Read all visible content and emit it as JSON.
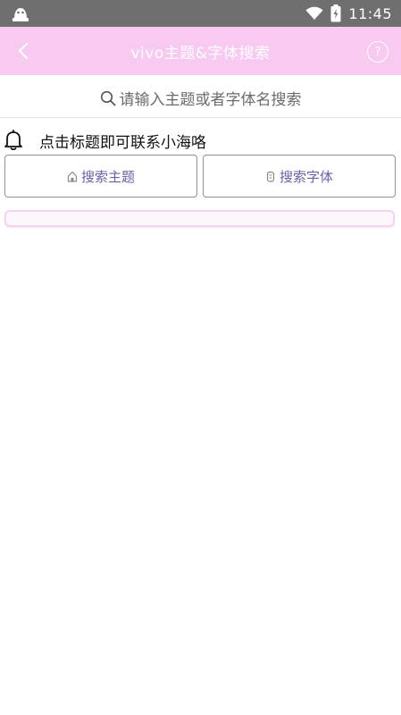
{
  "status_bar": {
    "time": "11:45",
    "icons": [
      "app-notification-icon",
      "wifi-icon",
      "battery-icon"
    ]
  },
  "app_bar": {
    "title": "vivo主题&字体搜索",
    "back_icon": "chevron-left-icon",
    "help_label": "?"
  },
  "search": {
    "placeholder": "请输入主题或者字体名搜索"
  },
  "notice": {
    "text": "点击标题即可联系小海咯"
  },
  "buttons": {
    "search_theme": "搜索主题",
    "search_font": "搜索字体"
  },
  "colors": {
    "status_bar": "#6f6f6f",
    "app_bar": "#f8c9f1",
    "button_text": "#6a5fa8",
    "results_border": "#f4d3ef"
  }
}
